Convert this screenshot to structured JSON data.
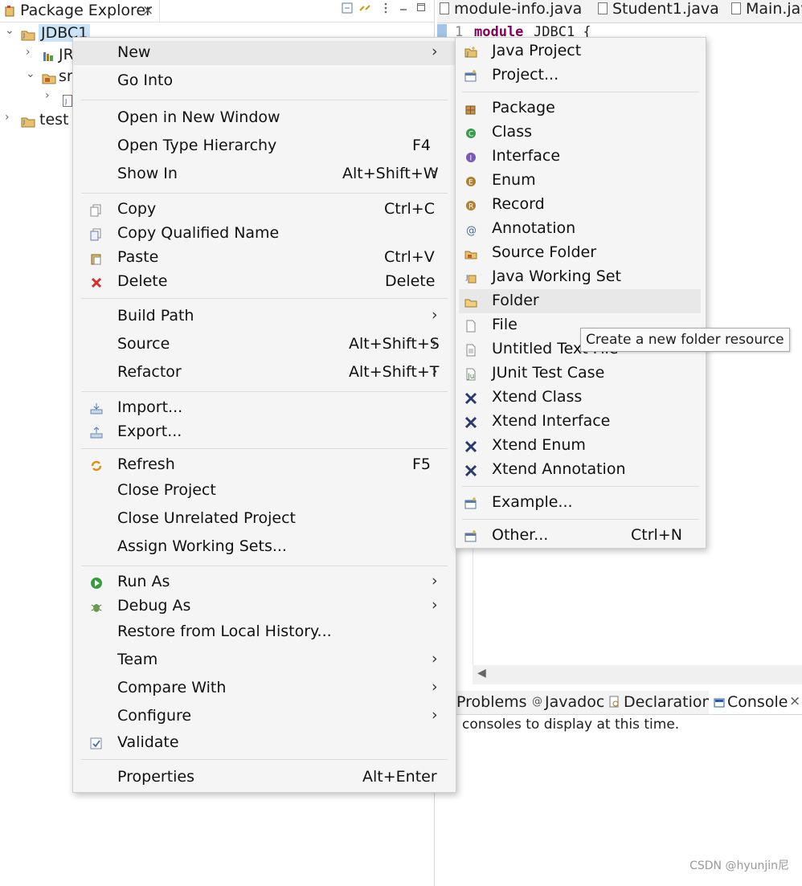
{
  "left_view": {
    "tab_title": "Package Explorer",
    "close_glyph": "×",
    "tree": [
      {
        "label": "JDBC1",
        "expanded": true
      },
      {
        "label": "JR"
      },
      {
        "label": "sr",
        "expanded": true
      },
      {
        "label": ""
      },
      {
        "label": "test"
      }
    ]
  },
  "editor": {
    "tabs": [
      "module-info.java",
      "Student1.java",
      "Main.jav"
    ],
    "line_number": "1",
    "code_keyword": "module",
    "code_rest": "JDBC1 {"
  },
  "bottom_panel": {
    "tabs": [
      "Problems",
      "Javadoc",
      "Declaration",
      "Console"
    ],
    "close_glyph": "×",
    "message": "consoles to display at this time."
  },
  "context_menu": {
    "items": [
      {
        "label": "New",
        "arrow": "›"
      },
      {
        "label": "Go Into"
      },
      {
        "label": "Open in New Window"
      },
      {
        "label": "Open Type Hierarchy",
        "shortcut": "F4"
      },
      {
        "label": "Show In",
        "shortcut": "Alt+Shift+W",
        "arrow": "›"
      },
      {
        "label": "Copy",
        "shortcut": "Ctrl+C",
        "icon": "copy-icon"
      },
      {
        "label": "Copy Qualified Name",
        "icon": "copy-qualified-icon"
      },
      {
        "label": "Paste",
        "shortcut": "Ctrl+V",
        "icon": "paste-icon"
      },
      {
        "label": "Delete",
        "shortcut": "Delete",
        "icon": "delete-icon"
      },
      {
        "label": "Build Path",
        "arrow": "›"
      },
      {
        "label": "Source",
        "shortcut": "Alt+Shift+S",
        "arrow": "›"
      },
      {
        "label": "Refactor",
        "shortcut": "Alt+Shift+T",
        "arrow": "›"
      },
      {
        "label": "Import...",
        "icon": "import-icon"
      },
      {
        "label": "Export...",
        "icon": "export-icon"
      },
      {
        "label": "Refresh",
        "shortcut": "F5",
        "icon": "refresh-icon"
      },
      {
        "label": "Close Project"
      },
      {
        "label": "Close Unrelated Project"
      },
      {
        "label": "Assign Working Sets..."
      },
      {
        "label": "Run As",
        "arrow": "›",
        "icon": "run-icon"
      },
      {
        "label": "Debug As",
        "arrow": "›",
        "icon": "debug-icon"
      },
      {
        "label": "Restore from Local History..."
      },
      {
        "label": "Team",
        "arrow": "›"
      },
      {
        "label": "Compare With",
        "arrow": "›"
      },
      {
        "label": "Configure",
        "arrow": "›"
      },
      {
        "label": "Validate",
        "icon": "validate-icon"
      },
      {
        "label": "Properties",
        "shortcut": "Alt+Enter"
      }
    ]
  },
  "new_submenu": {
    "items": [
      {
        "label": "Java Project"
      },
      {
        "label": "Project..."
      },
      {
        "label": "Package"
      },
      {
        "label": "Class"
      },
      {
        "label": "Interface"
      },
      {
        "label": "Enum"
      },
      {
        "label": "Record"
      },
      {
        "label": "Annotation"
      },
      {
        "label": "Source Folder"
      },
      {
        "label": "Java Working Set"
      },
      {
        "label": "Folder"
      },
      {
        "label": "File"
      },
      {
        "label": "Untitled Text File"
      },
      {
        "label": "JUnit Test Case"
      },
      {
        "label": "Xtend Class"
      },
      {
        "label": "Xtend Interface"
      },
      {
        "label": "Xtend Enum"
      },
      {
        "label": "Xtend Annotation"
      },
      {
        "label": "Example..."
      },
      {
        "label": "Other...",
        "shortcut": "Ctrl+N"
      }
    ]
  },
  "tooltip": "Create a new folder resource",
  "watermark": "CSDN @hyunjin尼",
  "colors": {
    "menu_bg": "#f5f5f5",
    "highlight": "#e8e8e8",
    "keyword": "#7f0055",
    "selection": "#cce4f7"
  }
}
